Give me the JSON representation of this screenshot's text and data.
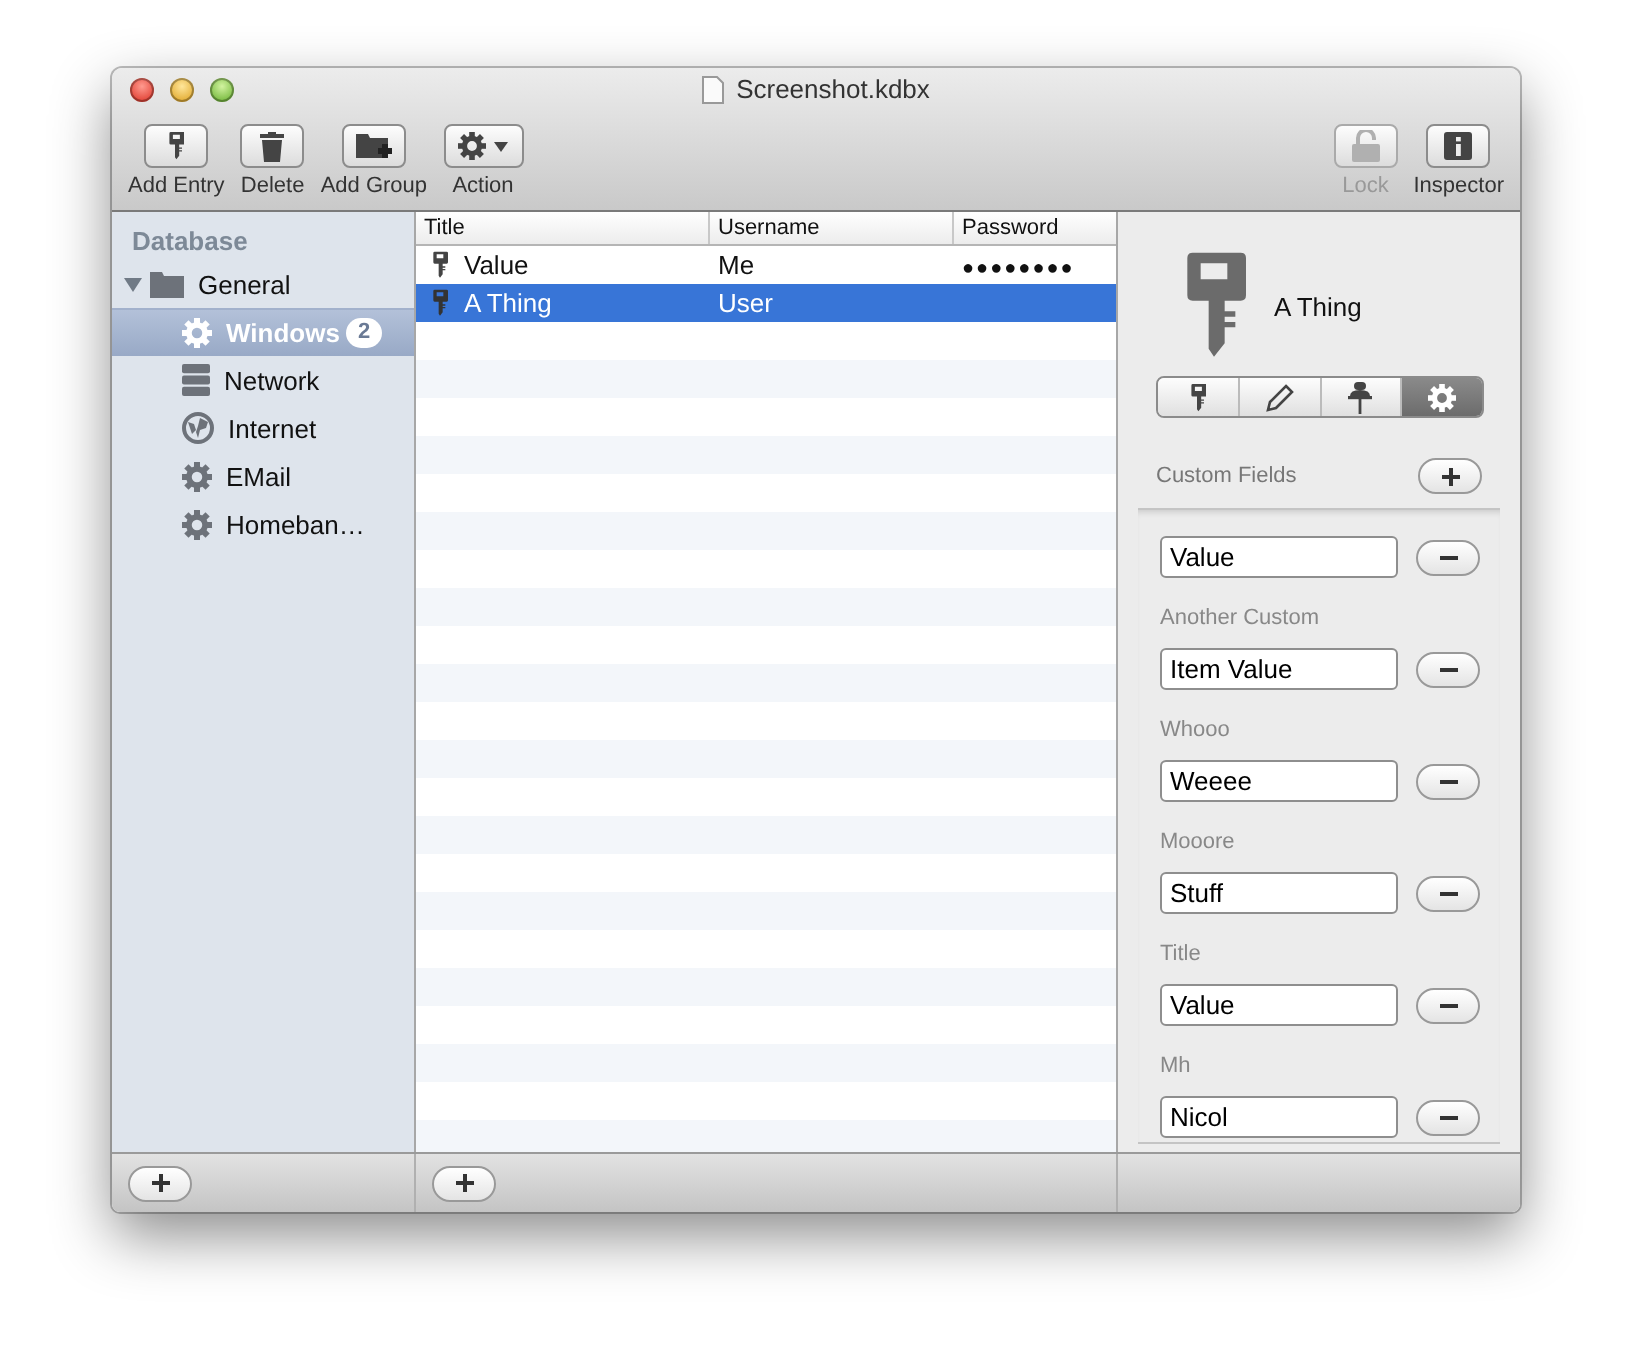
{
  "window": {
    "title": "Screenshot.kdbx"
  },
  "toolbar": {
    "left": [
      {
        "label": "Add Entry",
        "kind": "key",
        "disabled": false,
        "dropdown": false
      },
      {
        "label": "Delete",
        "kind": "trash",
        "disabled": false,
        "dropdown": false
      },
      {
        "label": "Add Group",
        "kind": "folder-plus",
        "disabled": false,
        "dropdown": false
      },
      {
        "label": "Action",
        "kind": "gear",
        "disabled": false,
        "dropdown": true
      }
    ],
    "right": [
      {
        "label": "Lock",
        "kind": "lock",
        "disabled": true,
        "dropdown": false
      },
      {
        "label": "Inspector",
        "kind": "info",
        "disabled": false,
        "dropdown": false
      }
    ]
  },
  "sidebar": {
    "heading": "Database",
    "items": [
      {
        "label": "General",
        "kind": "folder",
        "expanded": true,
        "selected": false,
        "children": [
          {
            "label": "Windows",
            "kind": "gear",
            "selected": true,
            "badge": "2"
          },
          {
            "label": "Network",
            "kind": "server",
            "selected": false
          },
          {
            "label": "Internet",
            "kind": "globe",
            "selected": false
          },
          {
            "label": "EMail",
            "kind": "gear",
            "selected": false
          },
          {
            "label": "Homeban…",
            "kind": "gear",
            "selected": false
          }
        ]
      }
    ]
  },
  "table": {
    "columns": [
      "Title",
      "Username",
      "Password"
    ],
    "rows": [
      {
        "title": "Value",
        "username": "Me",
        "password": "●●●●●●●●",
        "selected": false
      },
      {
        "title": "A Thing",
        "username": "User",
        "selected": true
      }
    ]
  },
  "inspector": {
    "name": "A Thing",
    "segments": [
      {
        "kind": "key",
        "selected": false
      },
      {
        "kind": "pencil",
        "selected": false
      },
      {
        "kind": "pin",
        "selected": false
      },
      {
        "kind": "gear",
        "selected": true
      }
    ],
    "section": "Custom Fields",
    "fields": [
      {
        "value": "Value"
      },
      {
        "label": "Another Custom",
        "value": "Item Value"
      },
      {
        "label": "Whooo",
        "value": "Weeee"
      },
      {
        "label": "Mooore",
        "value": "Stuff"
      },
      {
        "label": "Title",
        "value": "Value"
      },
      {
        "label": "Mh",
        "value": "Nicol"
      }
    ]
  }
}
